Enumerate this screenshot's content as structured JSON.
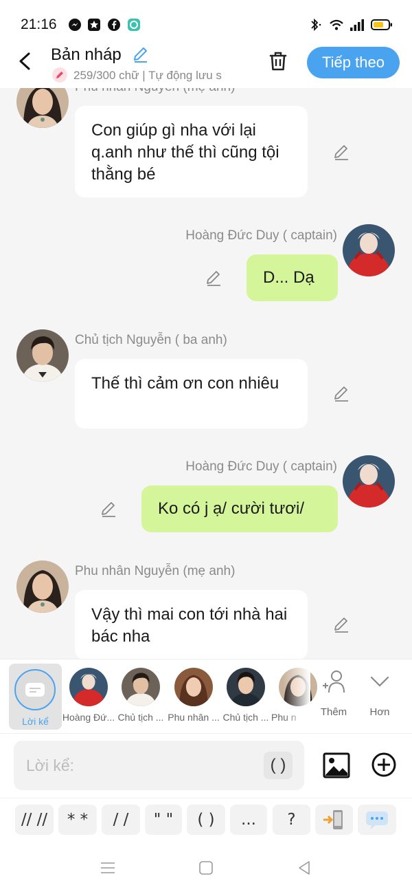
{
  "status_bar": {
    "time": "21:16"
  },
  "header": {
    "title": "Bản nháp",
    "subtitle": "259/300 chữ | Tự động lưu s",
    "next_label": "Tiếp theo"
  },
  "messages": [
    {
      "side": "left",
      "name": "Phu nhân Nguyễn (mẹ anh)",
      "text": "Con giúp gì nha với lại q.anh như thế thì cũng tội thằng bé",
      "avatar": "woman-avatar"
    },
    {
      "side": "right",
      "name": "Hoàng Đức Duy ( captain)",
      "text": "D... Dạ",
      "avatar": "red-hoodie-avatar"
    },
    {
      "side": "left",
      "name": "Chủ tịch Nguyễn ( ba anh)",
      "text": "Thế thì cảm ơn con nhiêu",
      "avatar": "man-avatar"
    },
    {
      "side": "right",
      "name": "Hoàng Đức Duy ( captain)",
      "text": "Ko có j ạ/ cười tươi/",
      "avatar": "red-hoodie-avatar"
    },
    {
      "side": "left",
      "name": "Phu nhân Nguyễn (mẹ anh)",
      "text": "Vậy thì mai con tới nhà hai bác nha",
      "avatar": "woman-avatar"
    }
  ],
  "characters": {
    "narration_label": "Lời kể",
    "items": [
      {
        "label": "Hoàng Đứ...",
        "avatar": "red-hoodie-avatar"
      },
      {
        "label": "Chủ tịch ...",
        "avatar": "man-avatar"
      },
      {
        "label": "Phu nhân ...",
        "avatar": "woman-avatar"
      },
      {
        "label": "Chủ tịch ...",
        "avatar": "young-man-avatar"
      },
      {
        "label": "Phu n",
        "avatar": "woman-avatar"
      }
    ],
    "add_label": "Thêm",
    "more_label": "Hơn"
  },
  "input": {
    "placeholder": "Lời kể:",
    "paren_button": "( )"
  },
  "format_buttons": [
    "// //",
    "* *",
    "/ /",
    "\" \"",
    "( )",
    "...",
    "?"
  ],
  "colors": {
    "accent": "#4aa3ef",
    "right_bubble": "#d5f59b",
    "background": "#f5f5f5"
  }
}
